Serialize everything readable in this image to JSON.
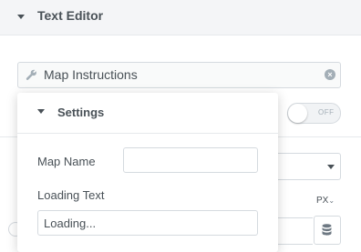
{
  "section": {
    "title": "Text Editor",
    "caret_icon": "caret-down-icon"
  },
  "query": {
    "icon": "wrench-icon",
    "value": "Map Instructions",
    "clear_icon": "clear-icon",
    "clear_glyph": "×"
  },
  "toggle": {
    "label": "OFF",
    "state": false
  },
  "unit": {
    "label": "PX",
    "chevron": "⌄"
  },
  "popover": {
    "title": "Settings",
    "fields": {
      "map_name": {
        "label": "Map Name",
        "value": ""
      },
      "loading_text": {
        "label": "Loading Text",
        "value": "Loading..."
      }
    }
  },
  "colors": {
    "text": "#495157",
    "border": "#d5dadf",
    "header_bg": "#f4f5f7"
  }
}
